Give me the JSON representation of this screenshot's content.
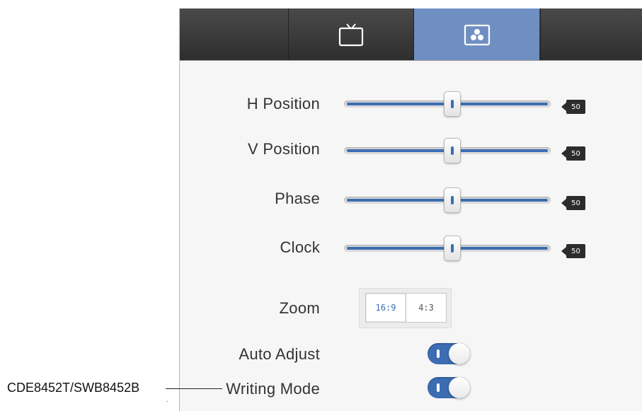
{
  "tabs": [
    {
      "name": "display",
      "icon": "tv-icon"
    },
    {
      "name": "picture",
      "icon": "picture-adjust-icon",
      "active": true
    }
  ],
  "sliders": [
    {
      "label": "H Position",
      "value": "50",
      "level": 0.5
    },
    {
      "label": "V Position",
      "value": "50",
      "level": 0.5
    },
    {
      "label": "Phase",
      "value": "50",
      "level": 0.5
    },
    {
      "label": "Clock",
      "value": "50",
      "level": 0.5
    }
  ],
  "zoom": {
    "label": "Zoom",
    "options": [
      "16:9",
      "4:3"
    ],
    "selected": "16:9"
  },
  "toggles": [
    {
      "label": "Auto Adjust",
      "state": "on"
    },
    {
      "label": "Writing Mode",
      "state": "on"
    }
  ],
  "annotation": {
    "model": "CDE8452T/SWB8452B"
  },
  "colors": {
    "accent": "#3c6db2",
    "active_tab": "#6f8fc3",
    "tab_bar": "#3a3a3a",
    "badge": "#2c2c2c"
  }
}
